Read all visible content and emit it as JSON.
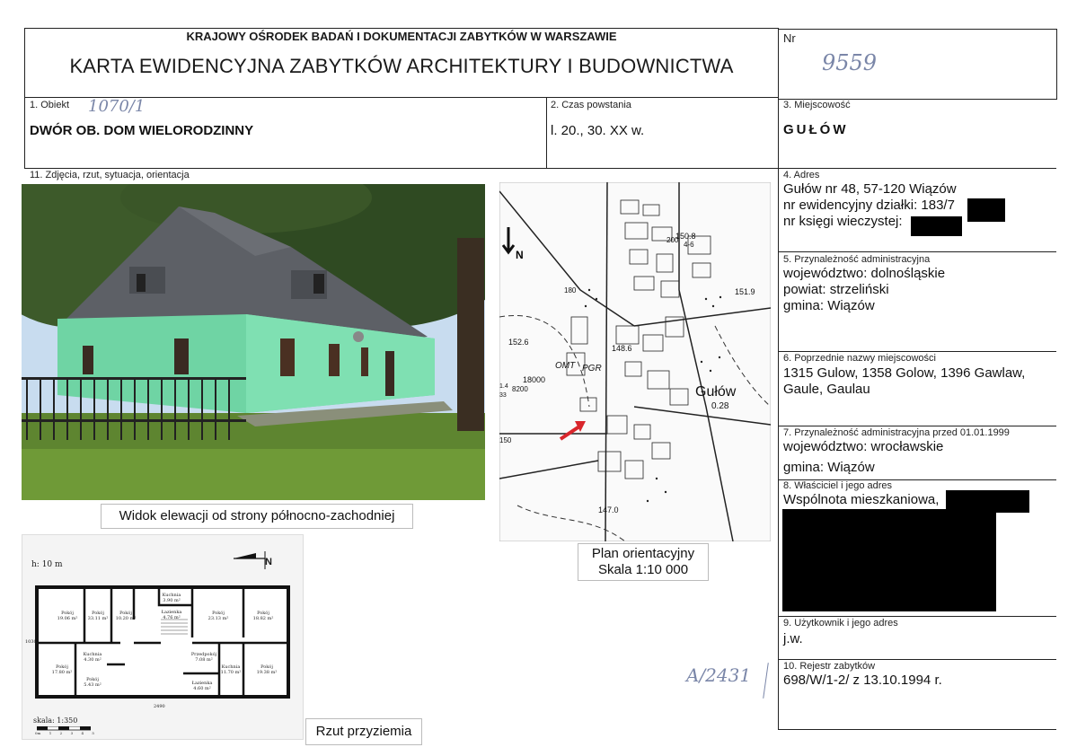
{
  "header": {
    "institution": "KRAJOWY OŚRODEK BADAŃ I DOKUMENTACJI ZABYTKÓW W WARSZAWIE",
    "title": "KARTA EWIDENCYJNA ZABYTKÓW ARCHITEKTURY I BUDOWNICTWA",
    "nr_label": "Nr",
    "nr_value": "9559"
  },
  "fields": {
    "obiekt": {
      "label": "1. Obiekt",
      "handwritten": "1070/1",
      "value": "DWÓR OB. DOM WIELORODZINNY"
    },
    "czas": {
      "label": "2. Czas powstania",
      "value": "l. 20., 30. XX w."
    },
    "miejscowosc": {
      "label": "3. Miejscowość",
      "value": "GUŁÓW"
    },
    "adres": {
      "label": "4. Adres",
      "line1": "Gułów nr 48, 57-120 Wiązów",
      "line2": "nr ewidencyjny działki: 183/7",
      "line3": "nr księgi wieczystej:"
    },
    "przynaleznosc": {
      "label": "5. Przynależność administracyjna",
      "line1": "województwo: dolnośląskie",
      "line2": "powiat: strzeliński",
      "line3": "gmina: Wiązów"
    },
    "poprzednie": {
      "label": "6. Poprzednie nazwy miejscowości",
      "line1": "1315 Gulow, 1358 Golow, 1396 Gawlaw,",
      "line2": "Gaule, Gaulau"
    },
    "przynaleznosc_przed": {
      "label": "7. Przynależność administracyjna przed 01.01.1999",
      "line1": "województwo: wrocławskie",
      "line2": "gmina: Wiązów"
    },
    "wlasciciel": {
      "label": "8. Właściciel i jego adres",
      "value": "Wspólnota mieszkaniowa,"
    },
    "uzytkownik": {
      "label": "9. Użytkownik i jego adres",
      "value": "j.w."
    },
    "rejestr": {
      "label": "10. Rejestr zabytków",
      "value": "698/W/1-2/ z 13.10.1994 r."
    }
  },
  "photos_section": {
    "label": "11. Zdjęcia, rzut, sytuacja, orientacja",
    "photo_caption": "Widok elewacji od strony północno-zachodniej",
    "map_caption_line1": "Plan orientacyjny",
    "map_caption_line2": "Skala 1:10 000",
    "plan_caption": "Rzut przyziemia",
    "handwritten_stamp": "A/2431"
  },
  "map": {
    "north": "N",
    "village_name": "Gułów",
    "labels": [
      "150.8",
      "200",
      "4-6",
      "151.9",
      "180",
      "152.6",
      "148.6",
      "OMT",
      "PGR",
      "18000",
      "8200",
      "1.4",
      "33",
      "0.28",
      "150",
      "147.0"
    ]
  },
  "floorplan": {
    "height_label": "h: 10 m",
    "north": "N",
    "scale_label": "skala: 1:350",
    "scale_ticks": [
      "0m",
      "1",
      "2",
      "3",
      "4",
      "5"
    ],
    "dimension": "2490",
    "side_dimension": "1030",
    "rooms": [
      {
        "name": "Pokój",
        "area": "19.06 m²"
      },
      {
        "name": "Pokój",
        "area": "33.11 m²"
      },
      {
        "name": "Pokój",
        "area": "10.20 m²"
      },
      {
        "name": "Kuchnia",
        "area": "3.90 m²"
      },
      {
        "name": "Łazienka",
        "area": "4.76 m²"
      },
      {
        "name": "Pokój",
        "area": "23.13 m²"
      },
      {
        "name": "Pokój",
        "area": "18.82 m²"
      },
      {
        "name": "Pokój",
        "area": "17.80 m²"
      },
      {
        "name": "Kuchnia",
        "area": "4.30 m²"
      },
      {
        "name": "Pokój",
        "area": "5.43 m²"
      },
      {
        "name": "Przedpokój",
        "area": "7.08 m²"
      },
      {
        "name": "Kuchnia",
        "area": "11.70 m²"
      },
      {
        "name": "Pokój",
        "area": "19.38 m²"
      },
      {
        "name": "Łazienka",
        "area": "4.60 m²"
      }
    ]
  },
  "colors": {
    "facade_green": "#6fd4a4",
    "roof_gray": "#5d6066",
    "sky": "#c8dcef",
    "grass": "#6f9a37",
    "arrow_red": "#d9262c",
    "handwriting": "#7a86a8"
  }
}
